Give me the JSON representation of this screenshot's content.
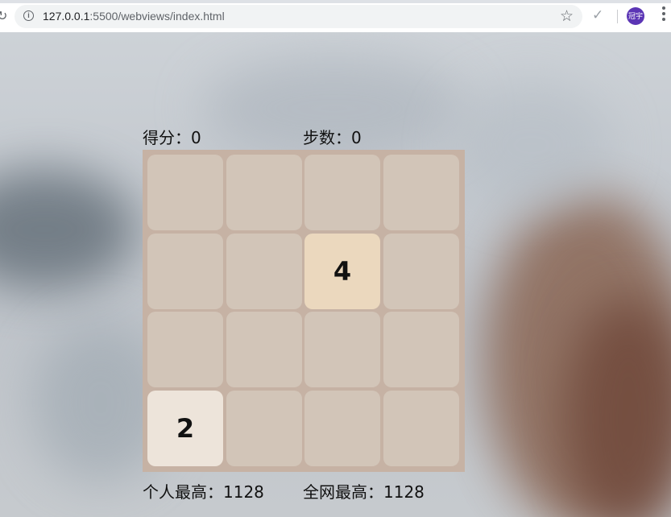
{
  "browser": {
    "url_host": "127.0.0.1",
    "url_path": ":5500/webviews/index.html",
    "avatar_text": "冠宇",
    "icons": [
      "info-icon",
      "star-icon",
      "check-icon",
      "avatar",
      "menu-icon"
    ]
  },
  "game": {
    "score_label": "得分：",
    "score_value": "0",
    "steps_label": "步数：",
    "steps_value": "0",
    "personal_best_label": "个人最高：",
    "personal_best_value": "1128",
    "global_best_label": "全网最高：",
    "global_best_value": "1128",
    "grid": [
      [
        "",
        "",
        "",
        ""
      ],
      [
        "",
        "",
        "4",
        ""
      ],
      [
        "",
        "",
        "",
        ""
      ],
      [
        "2",
        "",
        "",
        ""
      ]
    ],
    "colors": {
      "board": "#c6b2a4",
      "empty": "#d2c5b8",
      "tile_2": "#ede4da",
      "tile_4": "#ebd8be"
    }
  }
}
